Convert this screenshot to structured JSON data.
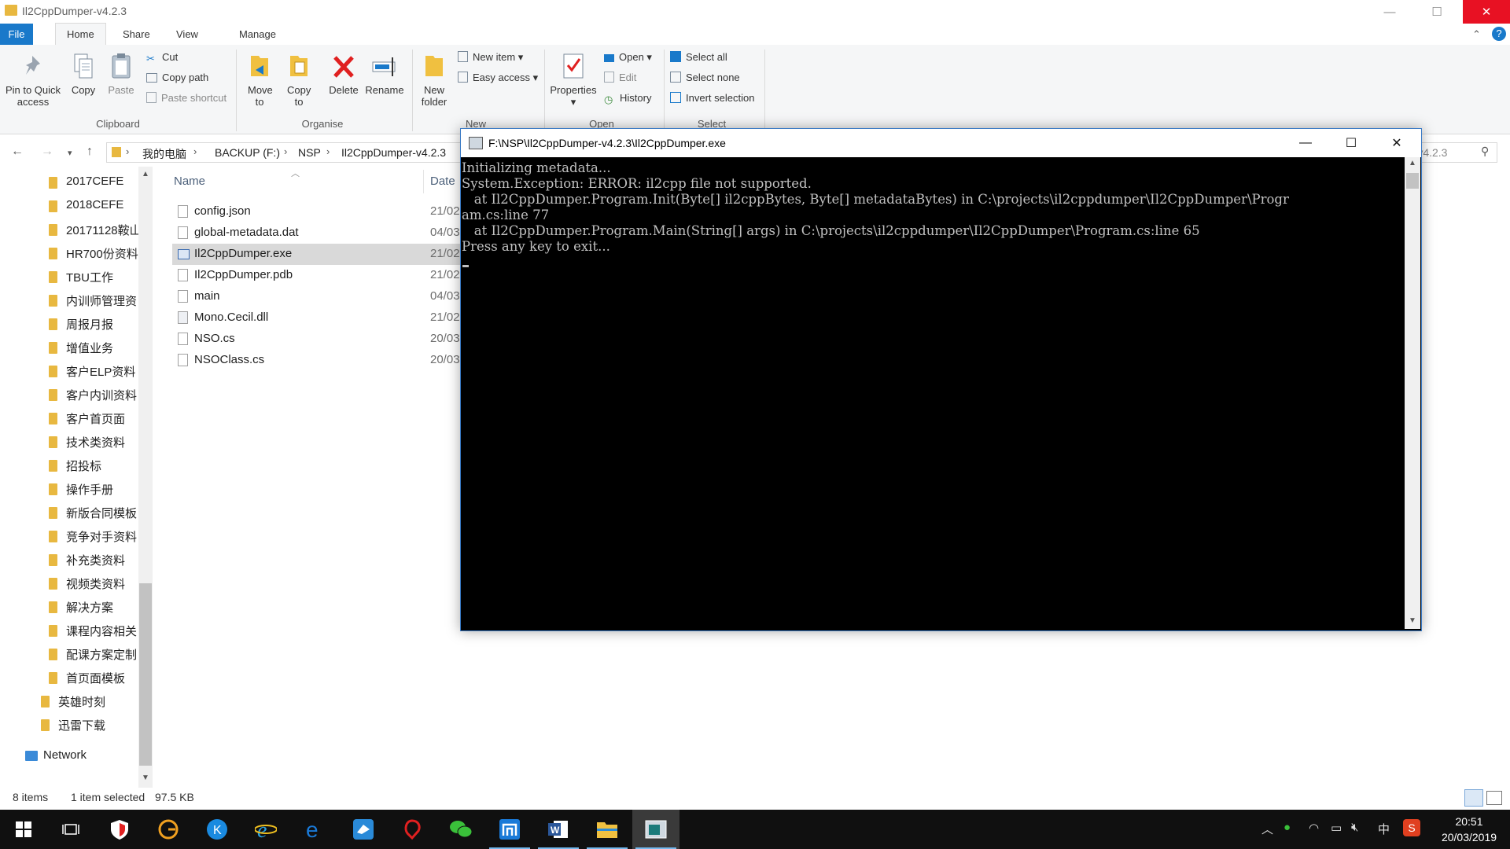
{
  "window": {
    "title": "Il2CppDumper-v4.2.3"
  },
  "tabs": [
    "File",
    "Home",
    "Share",
    "View",
    "Manage"
  ],
  "ribbon": {
    "clipboard": {
      "pin": "Pin to Quick access",
      "copy": "Copy",
      "paste": "Paste",
      "cut": "Cut",
      "copy_path": "Copy path",
      "paste_shortcut": "Paste shortcut",
      "group": "Clipboard"
    },
    "organise": {
      "move_to": "Move to",
      "copy_to": "Copy to",
      "delete": "Delete",
      "rename": "Rename",
      "group": "Organise"
    },
    "new": {
      "new_folder": "New folder",
      "new_item": "New item",
      "easy_access": "Easy access",
      "group": "New"
    },
    "open": {
      "properties": "Properties",
      "open": "Open",
      "edit": "Edit",
      "history": "History",
      "group": "Open"
    },
    "select": {
      "select_all": "Select all",
      "select_none": "Select none",
      "invert": "Invert selection",
      "group": "Select"
    }
  },
  "address": {
    "crumbs": [
      "我的电脑",
      "BACKUP (F:)",
      "NSP",
      "Il2CppDumper-v4.2.3"
    ],
    "search_fragment": "r-v4.2.3"
  },
  "nav": {
    "folders": [
      "2017CEFE",
      "2018CEFE",
      "20171128鞍山",
      "HR700份资料",
      "TBU工作",
      "内训师管理资",
      "周报月报",
      "增值业务",
      "客户ELP资料",
      "客户内训资料",
      "客户首页面",
      "技术类资料",
      "招投标",
      "操作手册",
      "新版合同模板",
      "竞争对手资料",
      "补充类资料",
      "视频类资料",
      "解决方案",
      "课程内容相关",
      "配课方案定制",
      "首页面模板"
    ],
    "folders2": [
      "英雄时刻",
      "迅雷下载"
    ],
    "network": "Network"
  },
  "files": {
    "headers": {
      "name": "Name",
      "date": "Date"
    },
    "rows": [
      {
        "name": "config.json",
        "date": "21/02"
      },
      {
        "name": "global-metadata.dat",
        "date": "04/03"
      },
      {
        "name": "Il2CppDumper.exe",
        "date": "21/02"
      },
      {
        "name": "Il2CppDumper.pdb",
        "date": "21/02"
      },
      {
        "name": "main",
        "date": "04/03"
      },
      {
        "name": "Mono.Cecil.dll",
        "date": "21/02"
      },
      {
        "name": "NSO.cs",
        "date": "20/03"
      },
      {
        "name": "NSOClass.cs",
        "date": "20/03"
      }
    ]
  },
  "status": {
    "items": "8 items",
    "selected": "1 item selected",
    "size": "97.5 KB"
  },
  "console": {
    "title": "F:\\NSP\\Il2CppDumper-v4.2.3\\Il2CppDumper.exe",
    "lines": [
      "Initializing metadata...",
      "System.Exception: ERROR: il2cpp file not supported.",
      "   at Il2CppDumper.Program.Init(Byte[] il2cppBytes, Byte[] metadataBytes) in C:\\projects\\il2cppdumper\\Il2CppDumper\\Progr",
      "am.cs:line 77",
      "   at Il2CppDumper.Program.Main(String[] args) in C:\\projects\\il2cppdumper\\Il2CppDumper\\Program.cs:line 65",
      "Press any key to exit..."
    ]
  },
  "taskbar": {
    "time": "20:51",
    "date": "20/03/2019",
    "ime": "中"
  },
  "colors": {
    "accent": "#1979ca",
    "selection": "#d9d9d9",
    "console_bg": "#000000",
    "console_text": "#c0c0c0",
    "folder": "#e8b840",
    "taskbar": "#101010"
  }
}
